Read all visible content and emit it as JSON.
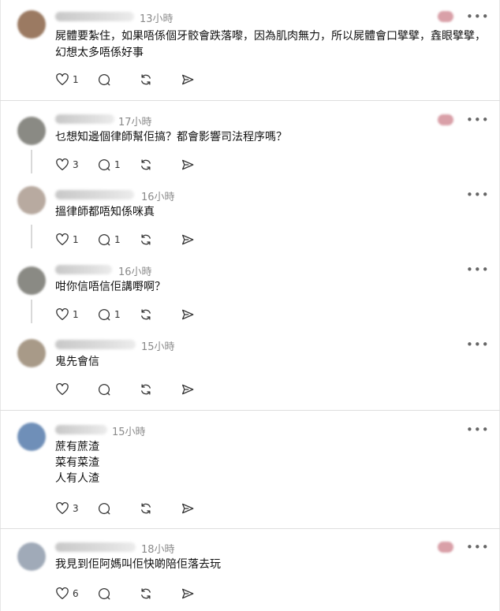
{
  "posts": [
    {
      "username": "(blurred)",
      "time": "13小時",
      "text": "屍體要紮住，如果唔係個牙骹會跌落嚟，因為肌肉無力，所以屍體會口擘擘，𠓾眼擘擘，幻想太多唔係好事",
      "likes": "1",
      "replies": "",
      "avatar_color": "#9b7a62"
    },
    {
      "username": "(blurred)",
      "time": "17小時",
      "text": "乜想知邊個律師幫佢搞？都會影響司法程序嗎？",
      "likes": "3",
      "replies": "1",
      "avatar_color": "#8a8a84"
    },
    {
      "username": "(blurred)",
      "time": "16小時",
      "text": "搵律師都唔知係咪真",
      "likes": "1",
      "replies": "1",
      "avatar_color": "#b8aaa0"
    },
    {
      "username": "(blurred)",
      "time": "16小時",
      "text": "咁你信唔信佢講嘢啊？",
      "likes": "1",
      "replies": "1",
      "avatar_color": "#8a8a84"
    },
    {
      "username": "(blurred)",
      "time": "15小時",
      "text": "鬼先會信",
      "likes": "",
      "replies": "",
      "avatar_color": "#a89a88"
    },
    {
      "username": "(blurred)",
      "time": "15小時",
      "text": "蔗有蔗渣\n菜有菜渣\n人有人渣",
      "likes": "3",
      "replies": "",
      "avatar_color": "#6f8fb8"
    },
    {
      "username": "(blurred)",
      "time": "18小時",
      "text": "我見到佢阿媽叫佢快啲陪佢落去玩",
      "likes": "6",
      "replies": "",
      "avatar_color": "#a0aab8"
    }
  ],
  "more_label": "•••",
  "flag_color": "#d9a0a8"
}
